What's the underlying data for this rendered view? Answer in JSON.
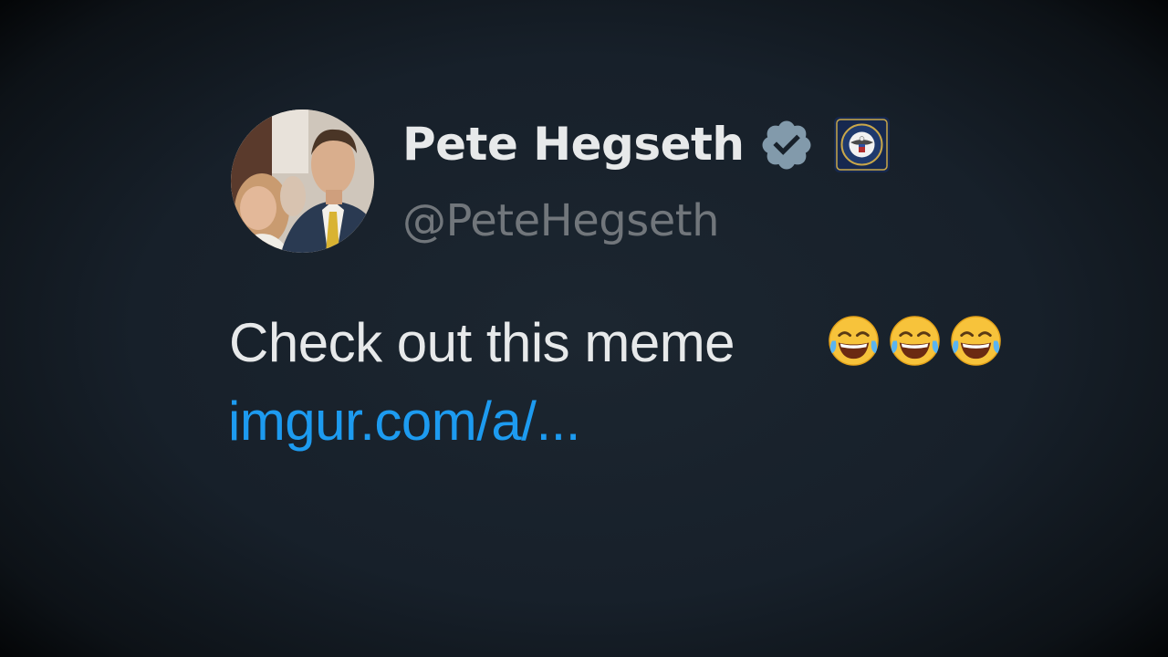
{
  "author": {
    "display_name": "Pete Hegseth",
    "handle": "@PeteHegseth",
    "avatar_icon": "profile-photo",
    "verified_icon": "verified-badge-icon",
    "affiliate_icon": "department-seal-icon"
  },
  "tweet": {
    "text": "Check out this meme",
    "emojis": [
      "😂",
      "😂",
      "😂"
    ],
    "link": "imgur.com/a/..."
  },
  "colors": {
    "background": "#17202a",
    "text": "#e7e9ea",
    "secondary_text": "#71767b",
    "link": "#1d9bf0",
    "verified_badge": "#829aab"
  }
}
